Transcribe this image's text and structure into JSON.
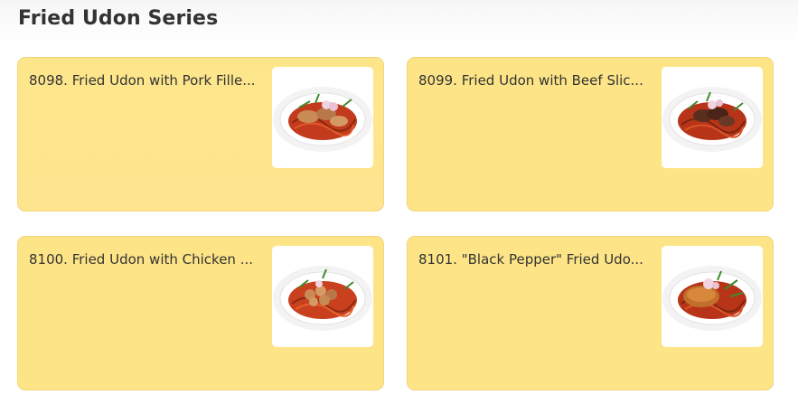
{
  "section": {
    "title": "Fried Udon Series"
  },
  "items": [
    {
      "name": "8098. Fried Udon with Pork Fille...",
      "image": "fried-udon-pork-image"
    },
    {
      "name": "8099. Fried Udon with Beef Slic...",
      "image": "fried-udon-beef-image"
    },
    {
      "name": "8100. Fried Udon with Chicken ...",
      "image": "fried-udon-chicken-image"
    },
    {
      "name": "8101. \"Black Pepper\" Fried Udo...",
      "image": "fried-udon-black-pepper-image"
    }
  ],
  "colors": {
    "card_background": "#fde587",
    "card_border": "#f2d47a",
    "title_text": "#333333"
  }
}
